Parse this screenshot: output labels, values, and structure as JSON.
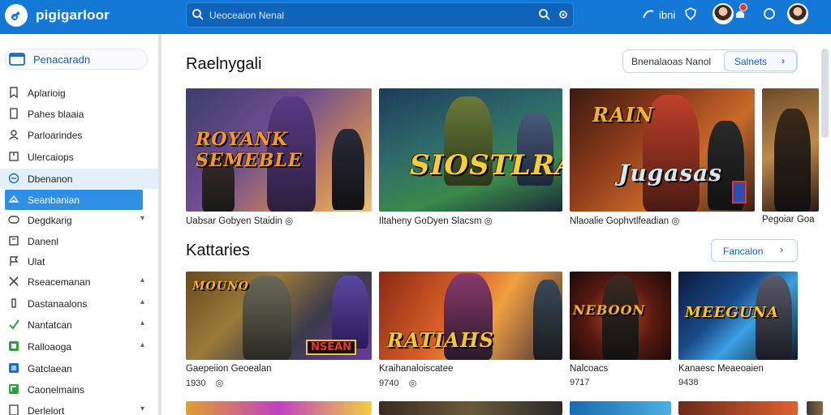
{
  "topbar": {
    "brand": "pigigarloor",
    "search_placeholder": "Ueoceaion Nenal",
    "user_text": "ibni",
    "color": "#1478d6"
  },
  "sidebar": {
    "header": "Penacaradn",
    "items": [
      {
        "label": "Aplarioig",
        "icon": "bookmark-icon"
      },
      {
        "label": "Pahes blaaia",
        "icon": "file-icon"
      },
      {
        "label": "Parloarindes",
        "icon": "people-icon"
      },
      {
        "label": "Ulercaiops",
        "icon": "tag-icon"
      },
      {
        "label": "Dbenanon",
        "icon": "circle-icon"
      },
      {
        "label": "Seanbanian",
        "icon": "game-icon"
      },
      {
        "label": "Degdkarig",
        "icon": "chat-icon"
      },
      {
        "label": "Danenl",
        "icon": "calendar-icon"
      },
      {
        "label": "Ulat",
        "icon": "flag-icon"
      },
      {
        "label": "Rseacemanan",
        "icon": "tools-icon"
      },
      {
        "label": "Dastanaalons",
        "icon": "bar-icon"
      },
      {
        "label": "Nantatcan",
        "icon": "check-icon"
      },
      {
        "label": "Ralloaoga",
        "icon": "green-square-icon"
      },
      {
        "label": "Gatclaean",
        "icon": "blue-square-icon"
      },
      {
        "label": "Caonelmains",
        "icon": "green-box-icon"
      },
      {
        "label": "Derlelort",
        "icon": "document-icon"
      }
    ]
  },
  "section1": {
    "title": "Raelnygali",
    "sort_label": "Bnenalaoas Nanol",
    "sort_button": "Salnets",
    "cards": [
      {
        "caption": "Uabsar Gobyen Staidin",
        "art": "ROYANK SEMEBLE"
      },
      {
        "caption": "Iltaheny GoDyen Slacsm",
        "art": "SIOSTLRA"
      },
      {
        "caption": "Nlaoalie Gophvtlfeadian",
        "art": "Jugasas"
      },
      {
        "caption": "Pegoiar Goa"
      }
    ]
  },
  "section2": {
    "title": "Kattaries",
    "button": "Fancalon",
    "cards": [
      {
        "caption": "Gaepeiion Geoealan",
        "sub": "1930",
        "art": "NSEAN"
      },
      {
        "caption": "Kraihanaloiscatee",
        "sub": "9740",
        "art": "RATIAHS"
      },
      {
        "caption": "Nalcoacs",
        "sub": "9717",
        "art": "NEBOON"
      },
      {
        "caption": "Kanaesc Meaeoaien",
        "sub": "9438",
        "art": "MEEGUNA"
      }
    ]
  }
}
